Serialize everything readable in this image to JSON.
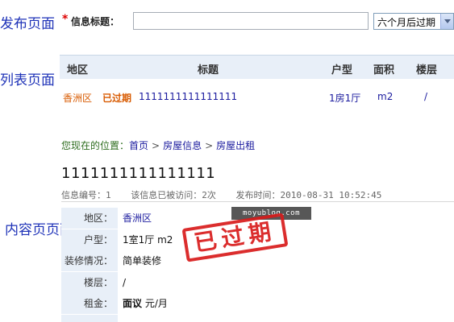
{
  "side_labels": {
    "publish": "发布页面",
    "list": "列表页面",
    "content": "内容页页面"
  },
  "publish_form": {
    "required_mark": "*",
    "title_label": "信息标题：",
    "title_value": "",
    "expire_option": "六个月后过期"
  },
  "list": {
    "headers": [
      "地区",
      "标题",
      "户型",
      "面积",
      "楼层"
    ],
    "row": {
      "district": "香洲区",
      "badge": "已过期",
      "title": "1111111111111111",
      "layout": "1房1厅",
      "area": "m2",
      "floor": "/"
    }
  },
  "breadcrumb": {
    "prefix": "您现在的位置：",
    "items": [
      "首页",
      "房屋信息",
      "房屋出租"
    ],
    "separator": ">"
  },
  "detail": {
    "title": "1111111111111111",
    "info_no": "信息编号：1",
    "visits": "该信息已被访问：2次",
    "published": "发布时间：2010-08-31 10:52:45",
    "rows": [
      {
        "label": "地区：",
        "value": "香洲区",
        "link": true
      },
      {
        "label": "户型：",
        "value": "1室1厅 m2",
        "link": false
      },
      {
        "label": "装修情况：",
        "value": "简单装修",
        "link": false
      },
      {
        "label": "楼层：",
        "value": "/",
        "link": false
      },
      {
        "label": "租金：",
        "value_bold": "面议",
        "value": "元/月",
        "link": false
      }
    ]
  },
  "watermark": "moyublog.com",
  "stamp": "已过期",
  "colors": {
    "side_label": "#1f33b8",
    "header_bg": "#e8eff8",
    "orange": "#d85a00",
    "link": "#1a1a9e",
    "stamp_red": "#d81c1c"
  }
}
